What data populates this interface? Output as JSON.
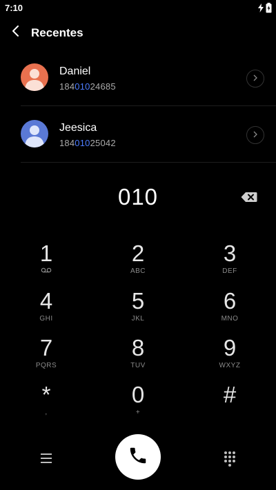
{
  "status_bar": {
    "time": "7:10"
  },
  "header": {
    "title": "Recentes"
  },
  "recents": [
    {
      "name": "Daniel",
      "number_pre": "184",
      "number_match": "010",
      "number_post": "24685",
      "avatar_color": "#e8714f"
    },
    {
      "name": "Jeesica",
      "number_pre": "184",
      "number_match": "010",
      "number_post": "25042",
      "avatar_color": "#5a79d6"
    }
  ],
  "dialer": {
    "dialed": "010"
  },
  "keypad": [
    {
      "digit": "1",
      "letters": ""
    },
    {
      "digit": "2",
      "letters": "ABC"
    },
    {
      "digit": "3",
      "letters": "DEF"
    },
    {
      "digit": "4",
      "letters": "GHI"
    },
    {
      "digit": "5",
      "letters": "JKL"
    },
    {
      "digit": "6",
      "letters": "MNO"
    },
    {
      "digit": "7",
      "letters": "PQRS"
    },
    {
      "digit": "8",
      "letters": "TUV"
    },
    {
      "digit": "9",
      "letters": "WXYZ"
    },
    {
      "digit": "*",
      "letters": ","
    },
    {
      "digit": "0",
      "letters": "+"
    },
    {
      "digit": "#",
      "letters": ""
    }
  ],
  "colors": {
    "accent": "#4d7dff",
    "background": "#000000",
    "call_button": "#ffffff"
  }
}
